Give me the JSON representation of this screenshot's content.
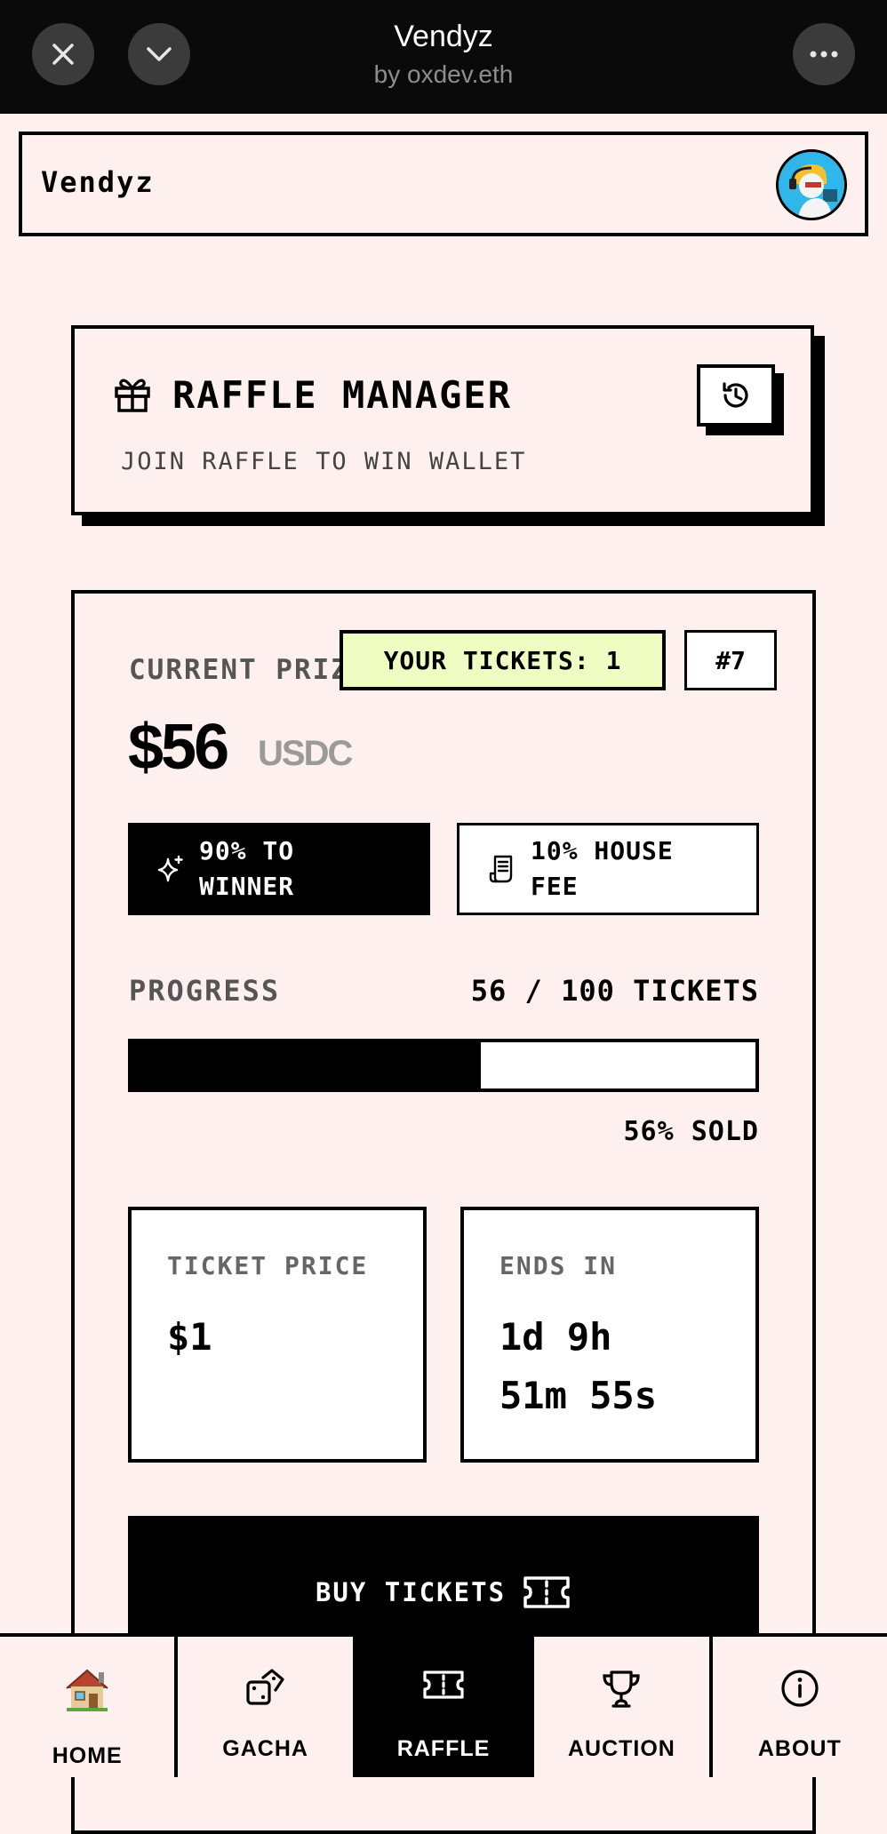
{
  "topbar": {
    "title": "Vendyz",
    "subtitle": "by oxdev.eth"
  },
  "header": {
    "brand": "Vendyz",
    "avatar_icon": "profile-avatar"
  },
  "raffle_manager": {
    "title": "RAFFLE MANAGER",
    "subtitle": "JOIN RAFFLE TO WIN WALLET"
  },
  "raffle": {
    "current_prize_label": "CURRENT PRIZE",
    "your_tickets": "YOUR TICKETS: 1",
    "raffle_number": "#7",
    "prize_amount": "$56",
    "prize_unit": "USDC",
    "winner_share_line1": "90% TO",
    "winner_share_line2": "WINNER",
    "house_fee_line1": "10% HOUSE",
    "house_fee_line2": "FEE",
    "progress_label": "PROGRESS",
    "progress_value": "56 / 100 TICKETS",
    "progress_fraction": 0.56,
    "sold_label": "56% SOLD",
    "ticket_price_label": "TICKET PRICE",
    "ticket_price_value": "$1",
    "ends_in_label": "ENDS IN",
    "ends_in_line1": "1d 9h",
    "ends_in_line2": "51m 55s",
    "buy_label": "BUY TICKETS"
  },
  "nav": {
    "items": [
      {
        "label": "HOME",
        "icon": "house-icon"
      },
      {
        "label": "GACHA",
        "icon": "dice-icon"
      },
      {
        "label": "RAFFLE",
        "icon": "ticket-icon",
        "active": true
      },
      {
        "label": "AUCTION",
        "icon": "trophy-icon"
      },
      {
        "label": "ABOUT",
        "icon": "info-icon"
      }
    ]
  },
  "colors": {
    "page_bg": "#fdf0ee",
    "tickets_badge": "#effdc2",
    "accent_dark": "#000000",
    "avatar_bg": "#2eb7e8"
  }
}
